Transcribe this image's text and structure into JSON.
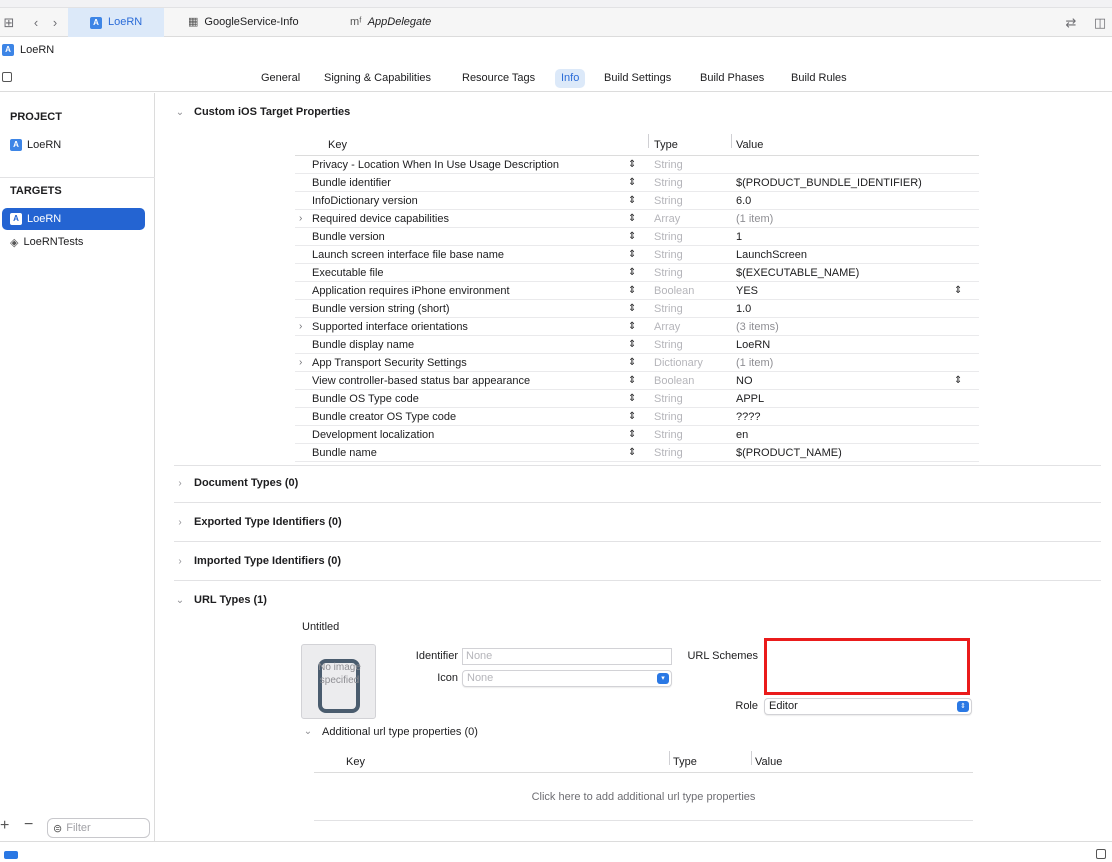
{
  "tabbar": {
    "tabs": [
      {
        "label": "LoeRN",
        "icon": "app-icon",
        "active": true
      },
      {
        "label": "GoogleService-Info",
        "icon": "table-icon",
        "active": false
      },
      {
        "label": "AppDelegate",
        "icon": "objc-file-icon",
        "active": false
      }
    ]
  },
  "breadcrumb": {
    "label": "LoeRN"
  },
  "segments": [
    "General",
    "Signing & Capabilities",
    "Resource Tags",
    "Info",
    "Build Settings",
    "Build Phases",
    "Build Rules"
  ],
  "active_segment": "Info",
  "sidebar": {
    "project_heading": "PROJECT",
    "project_item": "LoeRN",
    "targets_heading": "TARGETS",
    "targets": [
      {
        "label": "LoeRN",
        "selected": true
      },
      {
        "label": "LoeRNTests",
        "selected": false
      }
    ],
    "filter_placeholder": "Filter"
  },
  "custom_properties": {
    "title": "Custom iOS Target Properties",
    "headers": {
      "key": "Key",
      "type": "Type",
      "value": "Value"
    },
    "rows": [
      {
        "key": "Privacy - Location When In Use Usage Description",
        "type": "String",
        "value": "",
        "expandable": false,
        "value_popup": false
      },
      {
        "key": "Bundle identifier",
        "type": "String",
        "value": "$(PRODUCT_BUNDLE_IDENTIFIER)",
        "expandable": false,
        "value_popup": false
      },
      {
        "key": "InfoDictionary version",
        "type": "String",
        "value": "6.0",
        "expandable": false,
        "value_popup": false
      },
      {
        "key": "Required device capabilities",
        "type": "Array",
        "value": "(1 item)",
        "expandable": true,
        "value_popup": false
      },
      {
        "key": "Bundle version",
        "type": "String",
        "value": "1",
        "expandable": false,
        "value_popup": false
      },
      {
        "key": "Launch screen interface file base name",
        "type": "String",
        "value": "LaunchScreen",
        "expandable": false,
        "value_popup": false
      },
      {
        "key": "Executable file",
        "type": "String",
        "value": "$(EXECUTABLE_NAME)",
        "expandable": false,
        "value_popup": false
      },
      {
        "key": "Application requires iPhone environment",
        "type": "Boolean",
        "value": "YES",
        "expandable": false,
        "value_popup": true
      },
      {
        "key": "Bundle version string (short)",
        "type": "String",
        "value": "1.0",
        "expandable": false,
        "value_popup": false
      },
      {
        "key": "Supported interface orientations",
        "type": "Array",
        "value": "(3 items)",
        "expandable": true,
        "value_popup": false
      },
      {
        "key": "Bundle display name",
        "type": "String",
        "value": "LoeRN",
        "expandable": false,
        "value_popup": false
      },
      {
        "key": "App Transport Security Settings",
        "type": "Dictionary",
        "value": "(1 item)",
        "expandable": true,
        "value_popup": false
      },
      {
        "key": "View controller-based status bar appearance",
        "type": "Boolean",
        "value": "NO",
        "expandable": false,
        "value_popup": true
      },
      {
        "key": "Bundle OS Type code",
        "type": "String",
        "value": "APPL",
        "expandable": false,
        "value_popup": false
      },
      {
        "key": "Bundle creator OS Type code",
        "type": "String",
        "value": "????",
        "expandable": false,
        "value_popup": false
      },
      {
        "key": "Development localization",
        "type": "String",
        "value": "en",
        "expandable": false,
        "value_popup": false
      },
      {
        "key": "Bundle name",
        "type": "String",
        "value": "$(PRODUCT_NAME)",
        "expandable": false,
        "value_popup": false
      }
    ]
  },
  "collapsed_sections": [
    "Document Types (0)",
    "Exported Type Identifiers (0)",
    "Imported Type Identifiers (0)"
  ],
  "url_types": {
    "title": "URL Types (1)",
    "entry_title": "Untitled",
    "image_placeholder": "No image specified",
    "identifier_label": "Identifier",
    "identifier_placeholder": "None",
    "icon_label": "Icon",
    "icon_placeholder": "None",
    "url_schemes_label": "URL Schemes",
    "url_schemes_value": "",
    "role_label": "Role",
    "role_value": "Editor",
    "additional_title": "Additional url type properties (0)",
    "additional_headers": {
      "key": "Key",
      "type": "Type",
      "value": "Value"
    },
    "additional_hint": "Click here to add additional url type properties"
  },
  "colors": {
    "accent": "#2464d2",
    "highlight_box": "#ea1b1b",
    "tab_active_bg": "#dce9f9"
  }
}
